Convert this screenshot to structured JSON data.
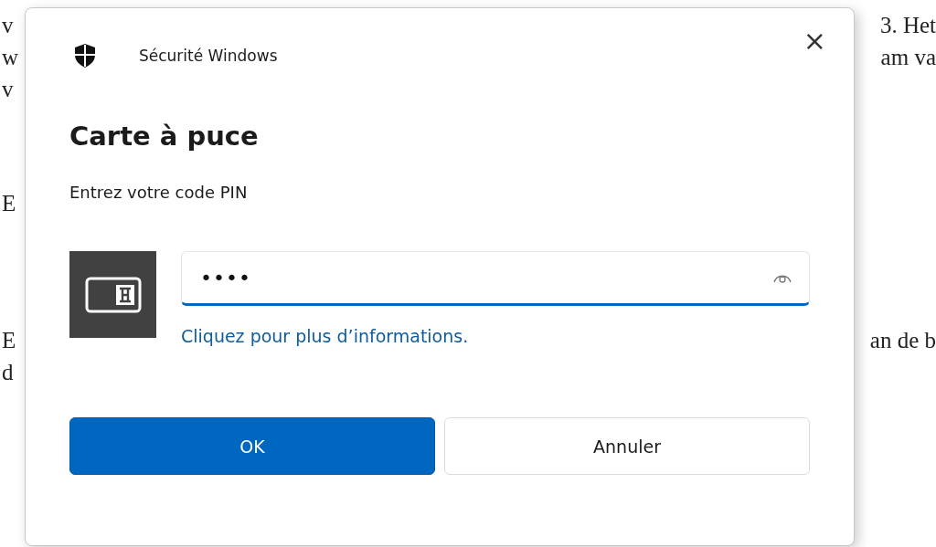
{
  "document": {
    "paragraphs": [
      {
        "lines": [
          {
            "left": "v",
            "right": "3. Het"
          },
          {
            "left": "w",
            "right": "am va"
          },
          {
            "left": "v"
          }
        ]
      },
      {
        "lines": [
          {
            "left": "E"
          }
        ]
      },
      {
        "lines": [
          {
            "left": "E",
            "right": "an de b"
          },
          {
            "left": "d"
          }
        ]
      }
    ]
  },
  "dialog": {
    "app_title": "Sécurité Windows",
    "close": "×",
    "heading": "Carte à puce",
    "prompt": "Entrez votre code PIN",
    "pin_field": {
      "value": "••••",
      "focused": true
    },
    "link": "Cliquez pour plus d’informations.",
    "buttons": [
      {
        "label": "OK",
        "kind": "primary"
      },
      {
        "label": "Annuler",
        "kind": "secondary"
      }
    ]
  }
}
